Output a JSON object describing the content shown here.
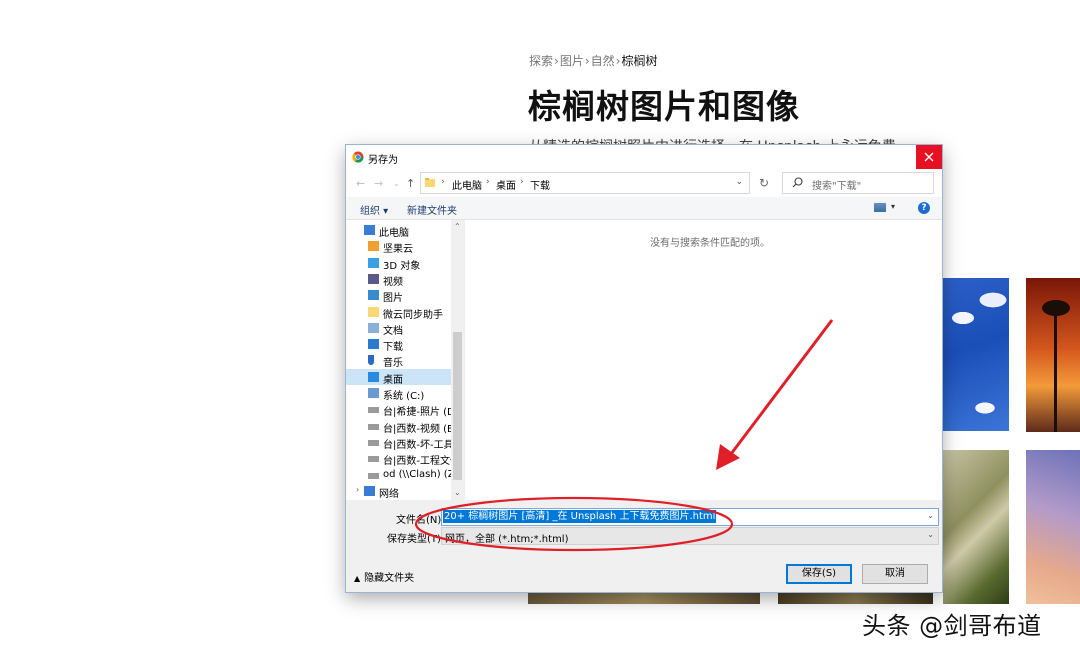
{
  "webpage": {
    "breadcrumb": [
      "探索",
      "图片",
      "自然",
      "棕榈树"
    ],
    "breadcrumb_sep": "›",
    "title": "棕榈树图片和图像",
    "description": "从精选的棕榈树照片中进行选择。在 Unsplash 上永远免费。"
  },
  "dialog": {
    "title": "另存为",
    "address": {
      "crumbs": [
        "此电脑",
        "桌面",
        "下载"
      ]
    },
    "search_placeholder": "搜索\"下载\"",
    "toolbar": {
      "organize": "组织 ▾",
      "new_folder": "新建文件夹",
      "help": "?"
    },
    "nav_items": [
      {
        "label": "此电脑",
        "icon": "computer-icon",
        "level": 0
      },
      {
        "label": "坚果云",
        "icon": "nutstore-icon",
        "level": 1
      },
      {
        "label": "3D 对象",
        "icon": "3d-objects-icon",
        "level": 1
      },
      {
        "label": "视频",
        "icon": "video-icon",
        "level": 1
      },
      {
        "label": "图片",
        "icon": "pictures-icon",
        "level": 1
      },
      {
        "label": "微云同步助手",
        "icon": "folder-icon",
        "level": 1
      },
      {
        "label": "文档",
        "icon": "documents-icon",
        "level": 1
      },
      {
        "label": "下载",
        "icon": "download-icon",
        "level": 1
      },
      {
        "label": "音乐",
        "icon": "music-icon",
        "level": 1
      },
      {
        "label": "桌面",
        "icon": "desktop-icon",
        "level": 1,
        "selected": true
      },
      {
        "label": "系统 (C:)",
        "icon": "drive-icon",
        "level": 1
      },
      {
        "label": "台|希捷-照片 (D:)",
        "icon": "network-drive-icon",
        "level": 1
      },
      {
        "label": "台|西数-视频 (E:)",
        "icon": "network-drive-icon",
        "level": 1
      },
      {
        "label": "台|西数-坏-工具",
        "icon": "network-drive-icon",
        "level": 1
      },
      {
        "label": "台|西数-工程文件",
        "icon": "network-drive-icon",
        "level": 1
      },
      {
        "label": "od (\\\\Clash) (Z:)",
        "icon": "network-drive-icon",
        "level": 1
      },
      {
        "label": "网络",
        "icon": "network-icon",
        "level": 0
      }
    ],
    "empty_message": "没有与搜索条件匹配的项。",
    "filename_label": "文件名(N):",
    "filename_value": "20+ 棕榈树图片 [高清] _在 Unsplash 上下载免费图片.html",
    "filetype_label": "保存类型(T):",
    "filetype_value": "网页，全部 (*.htm;*.html)",
    "hide_folders": "隐藏文件夹",
    "save_button": "保存(S)",
    "cancel_button": "取消"
  },
  "watermark": "头条 @剑哥布道",
  "colors": {
    "accent": "#0078d7",
    "close": "#e81123",
    "annotation": "#e02028",
    "selected_nav": "#cce4f7"
  }
}
